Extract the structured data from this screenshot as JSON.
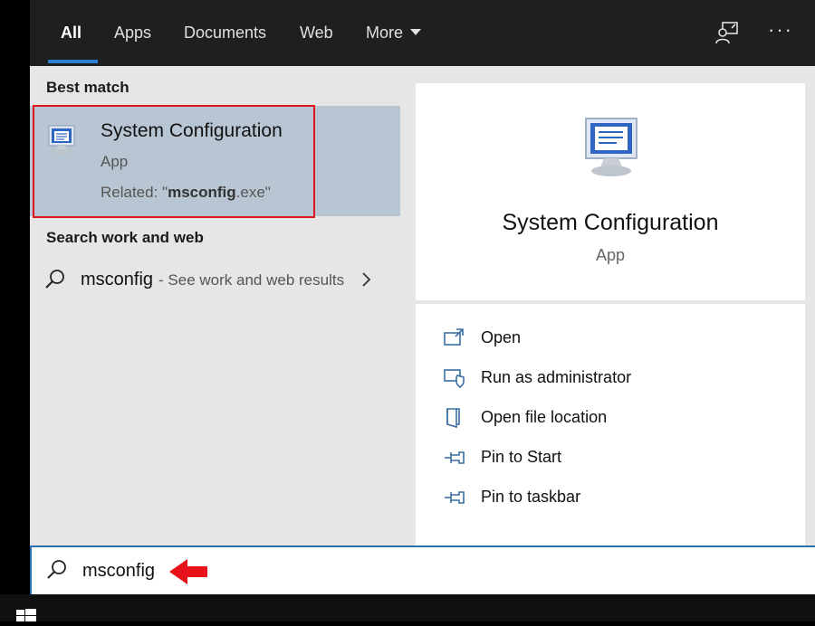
{
  "tabs": {
    "all": "All",
    "apps": "Apps",
    "documents": "Documents",
    "web": "Web",
    "more": "More"
  },
  "toolbar": {
    "more_options": "···",
    "feedback_icon": "feedback-icon"
  },
  "best_match": {
    "section_label": "Best match",
    "title": "System Configuration",
    "type": "App",
    "related_prefix": "Related: \"",
    "related_bold": "msconfig",
    "related_suffix": ".exe\""
  },
  "search_web": {
    "section_label": "Search work and web",
    "query": "msconfig",
    "hint": "- See work and web results"
  },
  "preview": {
    "title": "System Configuration",
    "type": "App",
    "actions": [
      {
        "label": "Open",
        "icon": "open-icon"
      },
      {
        "label": "Run as administrator",
        "icon": "shield-icon"
      },
      {
        "label": "Open file location",
        "icon": "folder-icon"
      },
      {
        "label": "Pin to Start",
        "icon": "pin-icon"
      },
      {
        "label": "Pin to taskbar",
        "icon": "pin-icon"
      }
    ]
  },
  "search_box": {
    "value": "msconfig"
  },
  "colors": {
    "accent": "#2d7fd3",
    "highlight_frame": "#e0141e",
    "selected_bg": "#b8c6d3",
    "arrow": "#e8121b"
  }
}
